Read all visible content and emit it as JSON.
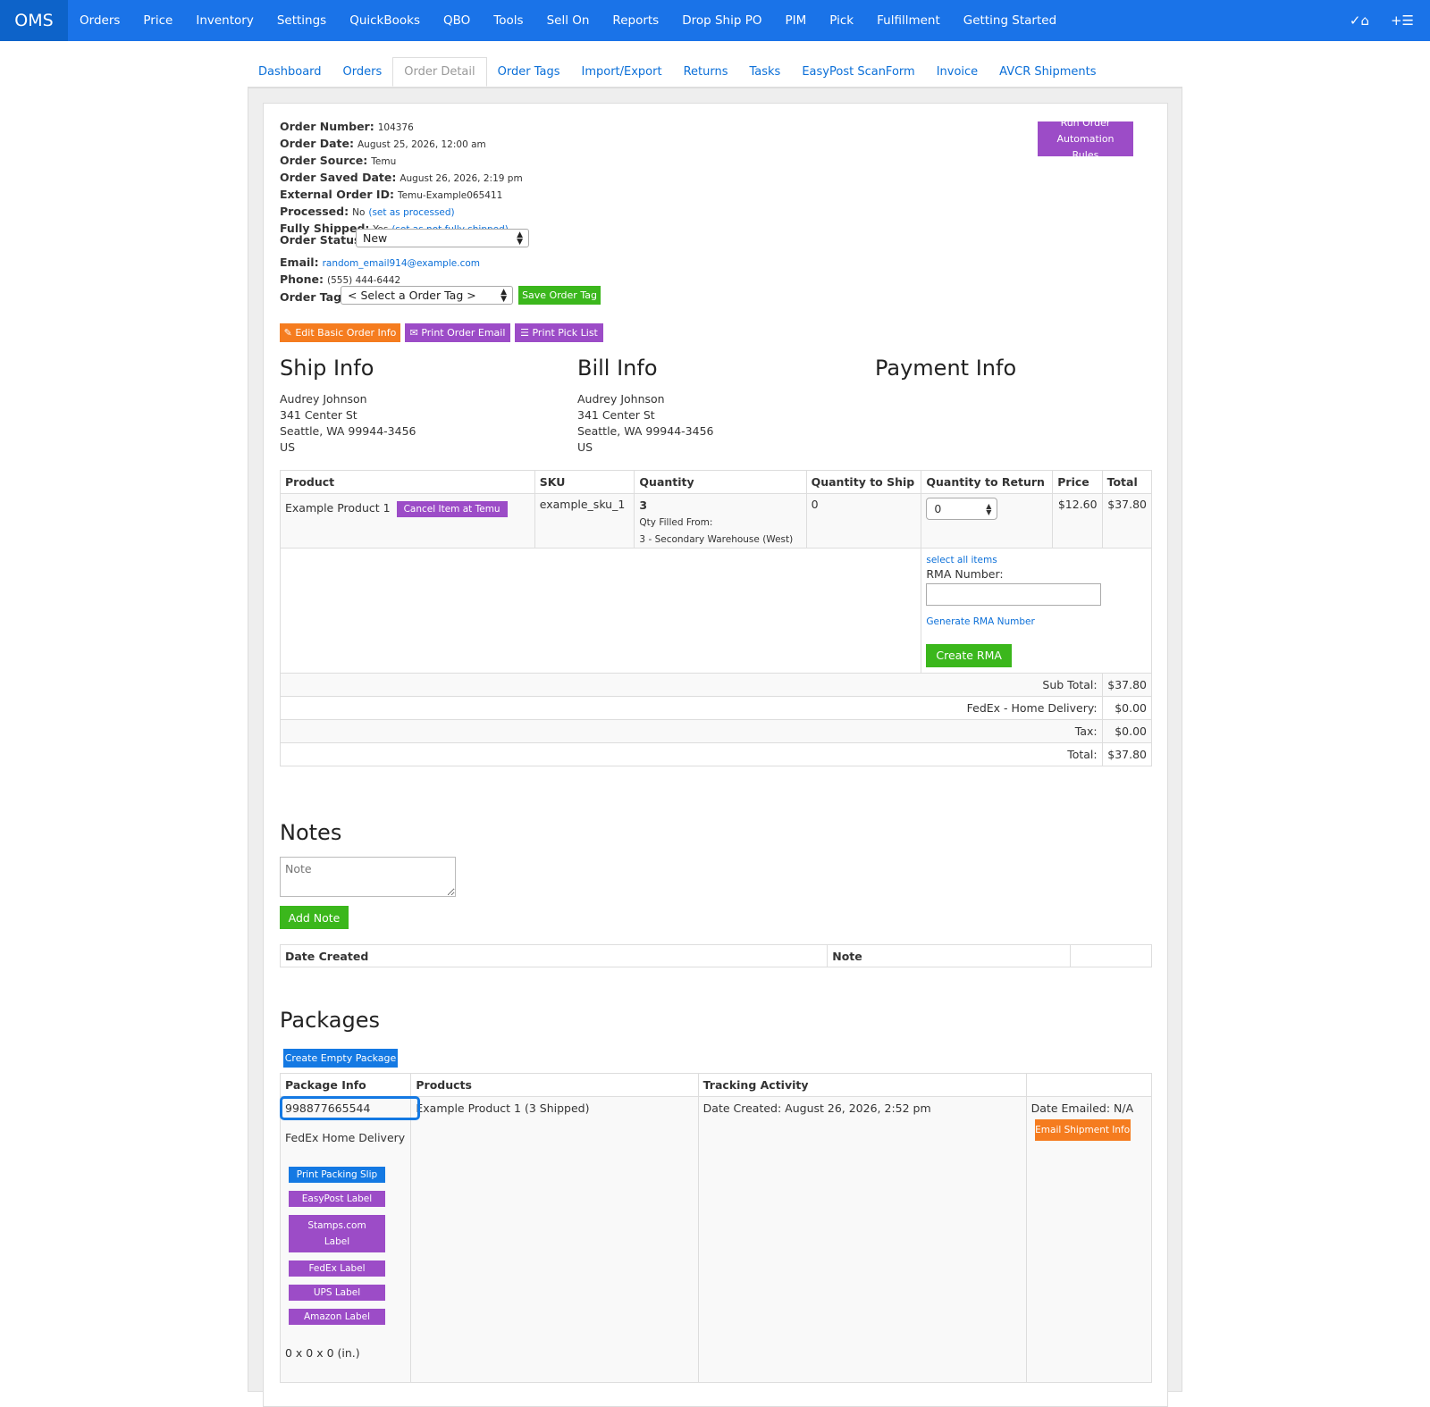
{
  "nav": {
    "brand": "OMS",
    "items": [
      "Orders",
      "Price",
      "Inventory",
      "Settings",
      "QuickBooks",
      "QBO",
      "Tools",
      "Sell On",
      "Reports",
      "Drop Ship PO",
      "PIM",
      "Pick",
      "Fulfillment",
      "Getting Started"
    ]
  },
  "subtabs": [
    "Dashboard",
    "Orders",
    "Order Detail",
    "Order Tags",
    "Import/Export",
    "Returns",
    "Tasks",
    "EasyPost ScanForm",
    "Invoice",
    "AVCR Shipments"
  ],
  "order": {
    "number_label": "Order Number:",
    "number": "104376",
    "date_label": "Order Date:",
    "date": "August 25, 2026, 12:00 am",
    "source_label": "Order Source:",
    "source": "Temu",
    "saved_label": "Order Saved Date:",
    "saved": "August 26, 2026, 2:19 pm",
    "external_label": "External Order ID:",
    "external": "Temu-Example065411",
    "processed_label": "Processed:",
    "processed": "No",
    "processed_link": "(set as processed)",
    "shipped_label": "Fully Shipped:",
    "shipped": "Yes",
    "shipped_link": "(set as not fully shipped)",
    "status_label": "Order Status:",
    "status": "New",
    "email_label": "Email:",
    "email": "random_email914@example.com",
    "phone_label": "Phone:",
    "phone": "(555) 444-6442",
    "tag_label": "Order Tag:",
    "tag_select": "< Select a Order Tag >",
    "save_tag": "Save Order Tag",
    "run_rules": "Run Order Automation Rules"
  },
  "actions": {
    "edit": "Edit Basic Order Info",
    "print_email": "Print Order Email",
    "pick_list": "Print Pick List"
  },
  "ship": {
    "title": "Ship Info",
    "name": "Audrey Johnson",
    "street": "341 Center St",
    "city": "Seattle, WA 99944-3456",
    "country": "US"
  },
  "bill": {
    "title": "Bill Info",
    "name": "Audrey Johnson",
    "street": "341 Center St",
    "city": "Seattle, WA 99944-3456",
    "country": "US"
  },
  "payment": {
    "title": "Payment Info"
  },
  "items_table": {
    "headers": [
      "Product",
      "SKU",
      "Quantity",
      "Quantity to Ship",
      "Quantity to Return",
      "Price",
      "Total"
    ],
    "row": {
      "product": "Example Product 1",
      "cancel": "Cancel Item at Temu",
      "sku": "example_sku_1",
      "qty": "3",
      "qty_filled": "Qty Filled From:",
      "qty_wh": "3 - Secondary Warehouse (West)",
      "to_ship": "0",
      "to_return": "0",
      "price": "$12.60",
      "total": "$37.80"
    },
    "select_all": "select all items",
    "rma_label": "RMA Number:",
    "generate_rma": "Generate RMA Number",
    "create_rma": "Create RMA",
    "subtotal_label": "Sub Total:",
    "subtotal": "$37.80",
    "shipping_label": "FedEx - Home Delivery:",
    "shipping": "$0.00",
    "tax_label": "Tax:",
    "tax": "$0.00",
    "total_label": "Total:",
    "total": "$37.80"
  },
  "notes": {
    "title": "Notes",
    "placeholder": "Note",
    "add": "Add Note",
    "col_date": "Date Created",
    "col_note": "Note"
  },
  "packages": {
    "title": "Packages",
    "create": "Create Empty Package",
    "headers": [
      "Package Info",
      "Products",
      "Tracking Activity",
      ""
    ],
    "tracking_no": "998877665544",
    "carrier": "FedEx Home Delivery",
    "buttons": [
      "Print Packing Slip",
      "EasyPost Label",
      "Stamps.com Label",
      "FedEx Label",
      "UPS Label",
      "Amazon Label"
    ],
    "dims": "0 x 0 x 0 (in.)",
    "products": "Example Product 1 (3 Shipped)",
    "tracking": "Date Created: August 26, 2026, 2:52 pm",
    "emailed": "Date Emailed: N/A",
    "email_btn": "Email Shipment Info"
  }
}
